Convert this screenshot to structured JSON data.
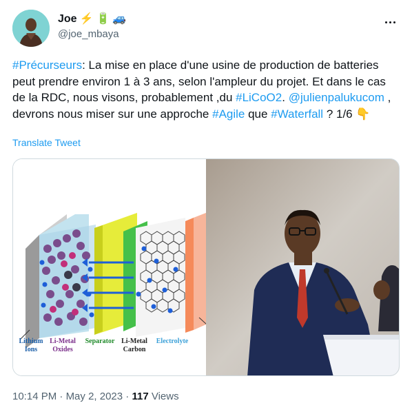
{
  "author": {
    "display_name": "Joe",
    "emojis": [
      "⚡",
      "🔋",
      "🚙"
    ],
    "handle": "@joe_mbaya"
  },
  "tweet": {
    "segments": [
      {
        "type": "link",
        "text": "#Précurseurs"
      },
      {
        "type": "text",
        "text": ": La mise en place d'une usine de production de batteries peut prendre environ 1 à 3 ans, selon l'ampleur du projet. Et dans le cas de la RDC, nous visons, probablement ,du "
      },
      {
        "type": "link",
        "text": "#LiCoO2"
      },
      {
        "type": "text",
        "text": ". "
      },
      {
        "type": "link",
        "text": "@julienpalukucom"
      },
      {
        "type": "text",
        "text": " , devrons nous miser sur une approche "
      },
      {
        "type": "link",
        "text": "#Agile"
      },
      {
        "type": "text",
        "text": " que "
      },
      {
        "type": "link",
        "text": "#Waterfall"
      },
      {
        "type": "text",
        "text": " ?  1/6 "
      },
      {
        "type": "text",
        "text": "👇"
      }
    ],
    "translate_label": "Translate Tweet"
  },
  "media": {
    "battery_labels": {
      "lithium_line1": "Lithium",
      "lithium_line2": "Ions",
      "limetal_oxides_line1": "Li-Metal",
      "limetal_oxides_line2": "Oxides",
      "separator": "Separator",
      "limetal_carbon_line1": "Li-Metal",
      "limetal_carbon_line2": "Carbon",
      "electrolyte": "Electrolyte"
    },
    "colors": {
      "lithium": "#1a5ea8",
      "oxides": "#7a2e8a",
      "separator": "#1f8a2a",
      "carbon": "#222222",
      "electrolyte": "#3aa0d8"
    }
  },
  "meta": {
    "time": "10:14 PM",
    "separator": " · ",
    "date": "May 2, 2023",
    "views_count": "117",
    "views_label": " Views"
  },
  "colors": {
    "link": "#1d9bf0",
    "secondary_text": "#536471"
  }
}
